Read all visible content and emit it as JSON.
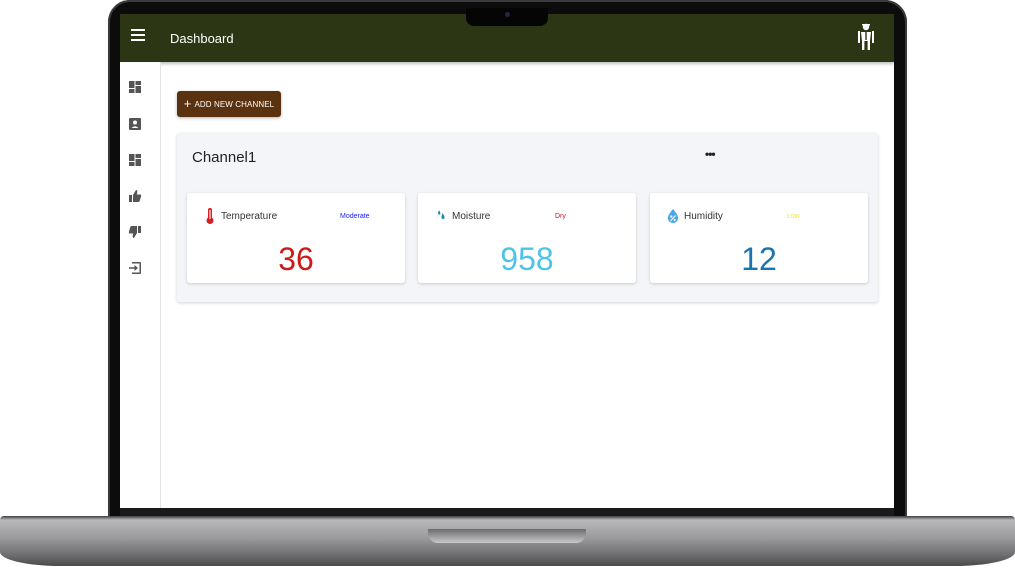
{
  "appbar": {
    "title": "Dashboard",
    "menu_icon": "hamburger-menu-icon",
    "avatar_icon": "user-avatar-icon"
  },
  "sidebar": {
    "items": [
      {
        "icon": "dashboard-icon"
      },
      {
        "icon": "contact-card-icon"
      },
      {
        "icon": "dashboard-alt-icon"
      },
      {
        "icon": "thumbs-up-icon"
      },
      {
        "icon": "thumbs-down-icon"
      },
      {
        "icon": "logout-icon"
      }
    ]
  },
  "actions": {
    "add_channel_plus": "+",
    "add_channel_label": "ADD NEW CHANNEL"
  },
  "channel": {
    "name": "Channel1",
    "more_label": "•••",
    "sensors": [
      {
        "label": "Temperature",
        "status": "Moderate",
        "value": "36",
        "icon": "thermometer-icon",
        "status_color": "#1a1aff",
        "value_color": "#cc1a1a"
      },
      {
        "label": "Moisture",
        "status": "Dry",
        "value": "958",
        "icon": "water-drops-icon",
        "status_color": "#d91a1a",
        "value_color": "#4fc3e6"
      },
      {
        "label": "Humidity",
        "status": "Low",
        "value": "12",
        "icon": "humidity-drop-icon",
        "status_color": "#f2f20d",
        "value_color": "#1a74b0"
      }
    ]
  },
  "colors": {
    "appbar_bg": "#2d3614",
    "button_bg": "#5b320f",
    "card_bg": "#f3f5f8"
  }
}
